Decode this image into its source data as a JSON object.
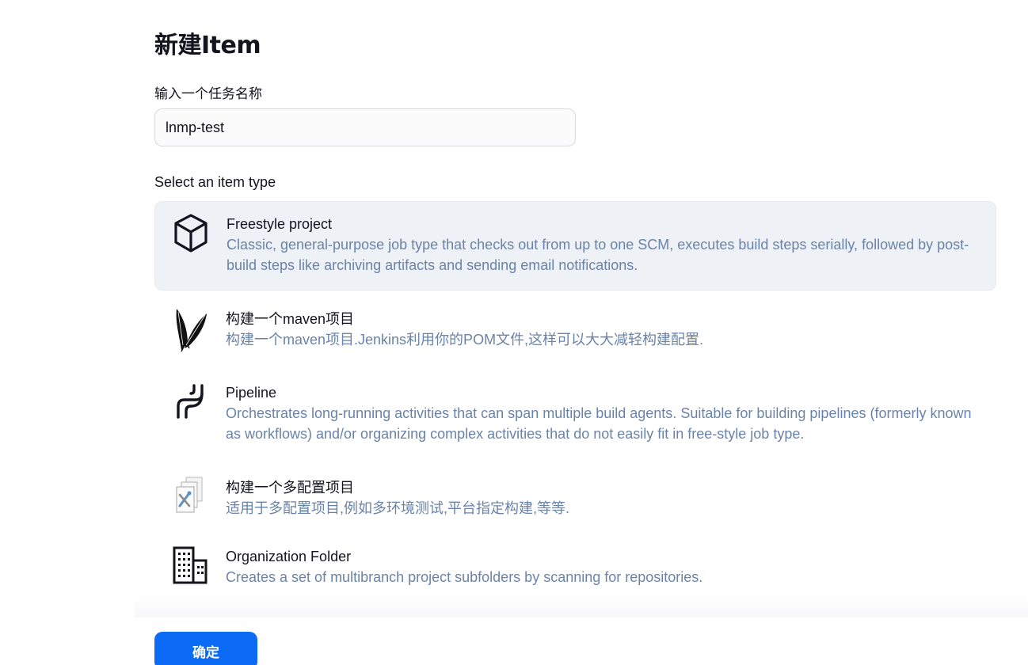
{
  "page": {
    "title": "新建Item",
    "name_label": "输入一个任务名称",
    "name_value": "lnmp-test",
    "type_label": "Select an item type"
  },
  "items": [
    {
      "name": "Freestyle project",
      "desc": "Classic, general-purpose job type that checks out from up to one SCM, executes build steps serially, followed by post-build steps like archiving artifacts and sending email notifications.",
      "icon": "cube-icon",
      "selected": true
    },
    {
      "name": "构建一个maven项目",
      "desc": "构建一个maven项目.Jenkins利用你的POM文件,这样可以大大减轻构建配置.",
      "icon": "maven-feather-icon",
      "selected": false
    },
    {
      "name": "Pipeline",
      "desc": "Orchestrates long-running activities that can span multiple build agents. Suitable for building pipelines (formerly known as workflows) and/or organizing complex activities that do not easily fit in free-style job type.",
      "icon": "pipeline-icon",
      "selected": false
    },
    {
      "name": "构建一个多配置项目",
      "desc": "适用于多配置项目,例如多环境测试,平台指定构建,等等.",
      "icon": "multi-config-icon",
      "selected": false
    },
    {
      "name": "Organization Folder",
      "desc": "Creates a set of multibranch project subfolders by scanning for repositories.",
      "icon": "building-icon",
      "selected": false
    }
  ],
  "footer": {
    "ok_label": "确定",
    "accent_color": "#0b6bf5"
  },
  "colors": {
    "selected_bg": "#eef1f6",
    "description_text": "#6a83a8"
  }
}
